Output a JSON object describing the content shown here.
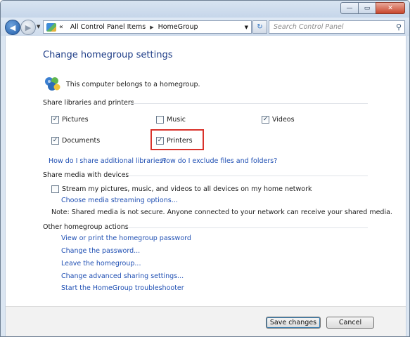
{
  "window": {
    "minimize_glyph": "—",
    "maximize_glyph": "▭",
    "close_glyph": "✕"
  },
  "nav": {
    "back_glyph": "◀",
    "forward_glyph": "▶",
    "history_dropdown_glyph": "▼",
    "breadcrumb": [
      "All Control Panel Items",
      "HomeGroup"
    ],
    "breadcrumb_sep": "▶",
    "address_prefix_sep": "«",
    "address_dropdown_glyph": "▼",
    "refresh_glyph": "↻",
    "search_placeholder": "Search Control Panel",
    "search_glyph": "⚲"
  },
  "page": {
    "title": "Change homegroup settings",
    "membership_text": "This computer belongs to a homegroup.",
    "share_section_label": "Share libraries and printers",
    "libraries": [
      {
        "label": "Pictures",
        "checked": true
      },
      {
        "label": "Music",
        "checked": false
      },
      {
        "label": "Videos",
        "checked": true
      },
      {
        "label": "Documents",
        "checked": true
      },
      {
        "label": "Printers",
        "checked": true
      }
    ],
    "check_glyph": "✓",
    "link_share_additional": "How do I share additional libraries?",
    "link_exclude": "How do I exclude files and folders?",
    "media_section_label": "Share media with devices",
    "media_stream_label": "Stream my pictures, music, and videos to all devices on my home network",
    "media_stream_checked": false,
    "link_media_options": "Choose media streaming options...",
    "media_note": "Note: Shared media is not secure. Anyone connected to your network can receive your shared media.",
    "other_section_label": "Other homegroup actions",
    "actions": [
      "View or print the homegroup password",
      "Change the password...",
      "Leave the homegroup...",
      "Change advanced sharing settings...",
      "Start the HomeGroup troubleshooter"
    ]
  },
  "footer": {
    "save_label": "Save changes",
    "cancel_label": "Cancel"
  },
  "colors": {
    "link": "#1f4fb3",
    "title": "#1e3d87",
    "highlight_border": "#d9322b"
  }
}
